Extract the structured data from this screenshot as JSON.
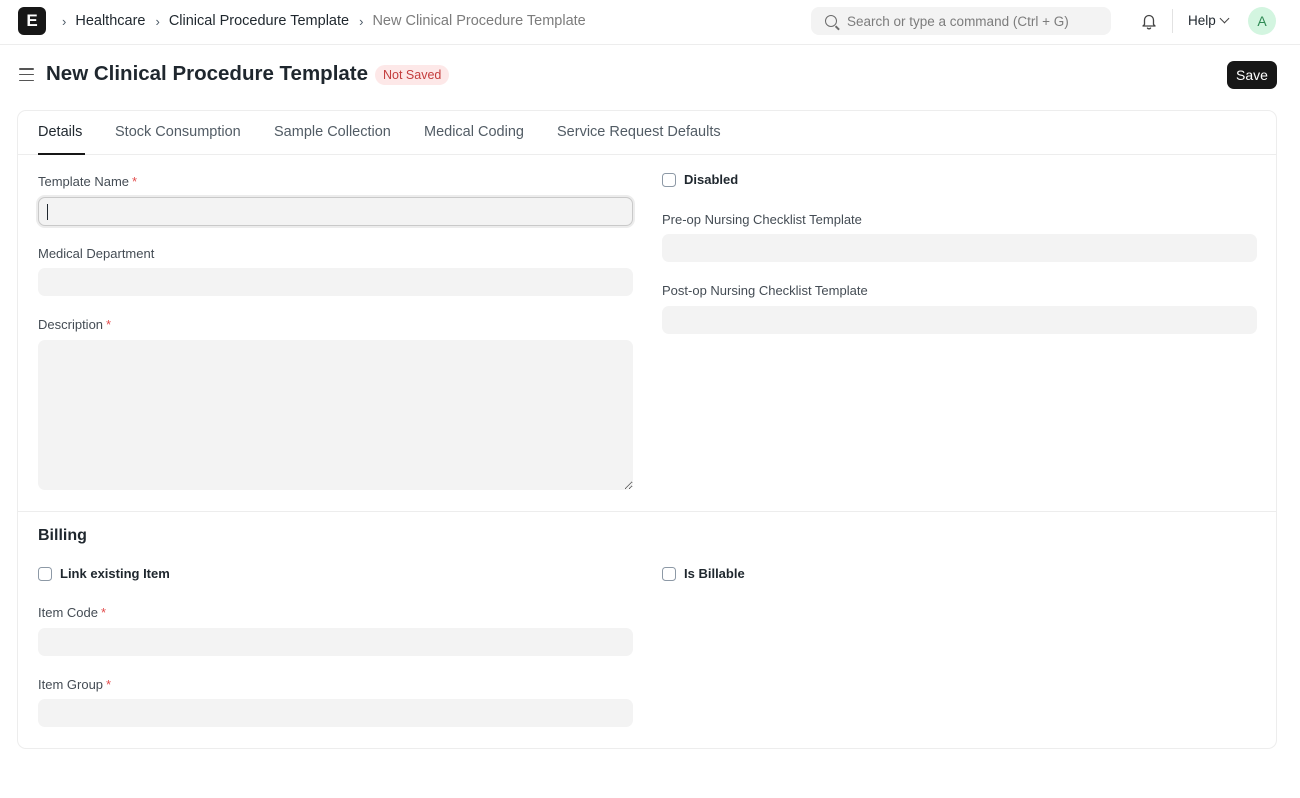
{
  "navbar": {
    "logo_letter": "E",
    "breadcrumbs": [
      "Healthcare",
      "Clinical Procedure Template",
      "New Clinical Procedure Template"
    ],
    "search_placeholder": "Search or type a command (Ctrl + G)",
    "help_label": "Help",
    "avatar_initial": "A"
  },
  "page": {
    "title": "New Clinical Procedure Template",
    "status_badge": "Not Saved",
    "save_label": "Save"
  },
  "tabs": [
    "Details",
    "Stock Consumption",
    "Sample Collection",
    "Medical Coding",
    "Service Request Defaults"
  ],
  "details": {
    "template_name_label": "Template Name",
    "template_name_value": "",
    "medical_department_label": "Medical Department",
    "medical_department_value": "",
    "description_label": "Description",
    "description_value": "",
    "disabled_label": "Disabled",
    "disabled_checked": false,
    "pre_op_label": "Pre-op Nursing Checklist Template",
    "pre_op_value": "",
    "post_op_label": "Post-op Nursing Checklist Template",
    "post_op_value": ""
  },
  "billing": {
    "section_title": "Billing",
    "link_existing_item_label": "Link existing Item",
    "is_billable_label": "Is Billable",
    "item_code_label": "Item Code",
    "item_code_value": "",
    "item_group_label": "Item Group",
    "item_group_value": ""
  },
  "colors": {
    "primary_button": "#171717",
    "badge_bg": "#fde8e8",
    "badge_text": "#c43d3d",
    "required_marker": "#e24c4c",
    "field_bg": "#f3f3f3",
    "avatar_bg": "#d3f5e0"
  }
}
